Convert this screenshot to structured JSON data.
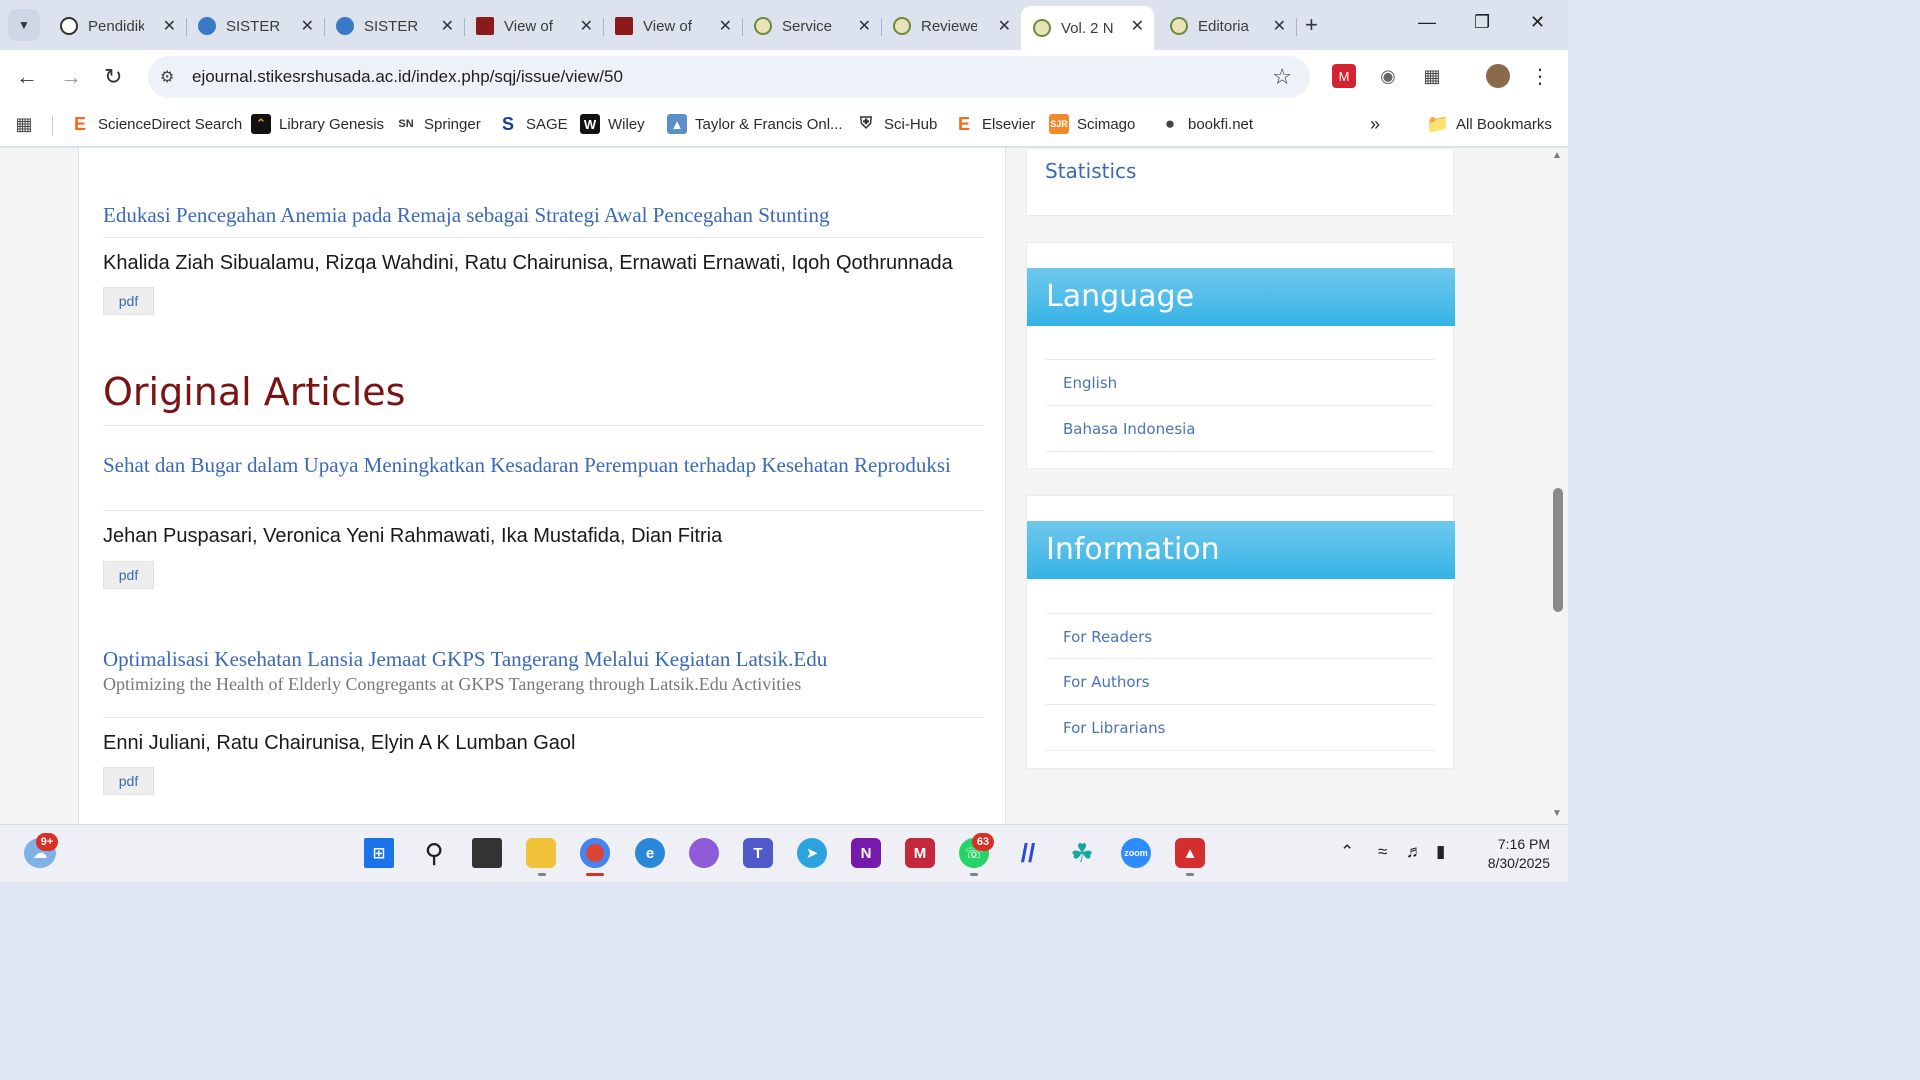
{
  "browser": {
    "tabs": [
      {
        "title": "Pendidik",
        "icon": "openai-icon"
      },
      {
        "title": "SISTER |",
        "icon": "sister-icon"
      },
      {
        "title": "SISTER |",
        "icon": "sister-icon"
      },
      {
        "title": "View of",
        "icon": "acta-medica-icon"
      },
      {
        "title": "View of",
        "icon": "acta-medica-icon"
      },
      {
        "title": "Service",
        "icon": "journal-seal-icon"
      },
      {
        "title": "Reviewe",
        "icon": "journal-seal-icon"
      },
      {
        "title": "Vol. 2 N",
        "icon": "journal-seal-icon",
        "active": true
      },
      {
        "title": "Editoria",
        "icon": "journal-seal-icon"
      }
    ],
    "url": "ejournal.stikesrshusada.ac.id/index.php/sqj/issue/view/50",
    "bookmarks": [
      {
        "label": "ScienceDirect Search",
        "icon": "elsevier-icon"
      },
      {
        "label": "Library Genesis",
        "icon": "libgen-icon"
      },
      {
        "label": "Springer",
        "icon": "springer-icon"
      },
      {
        "label": "SAGE",
        "icon": "sage-icon"
      },
      {
        "label": "Wiley",
        "icon": "wiley-icon"
      },
      {
        "label": "Taylor & Francis Onl...",
        "icon": "tandf-icon"
      },
      {
        "label": "Sci-Hub",
        "icon": "scihub-icon"
      },
      {
        "label": "Elsevier",
        "icon": "elsevier-icon"
      },
      {
        "label": "Scimago",
        "icon": "scimago-icon"
      },
      {
        "label": "bookfi.net",
        "icon": "globe-icon"
      }
    ],
    "all_bookmarks": "All Bookmarks"
  },
  "main": {
    "articles": [
      {
        "title": "Edukasi Pencegahan Anemia pada Remaja sebagai Strategi Awal Pencegahan Stunting",
        "authors": "Khalida Ziah Sibualamu, Rizqa Wahdini, Ratu Chairunisa, Ernawati Ernawati, Iqoh Qothrunnada",
        "pdf": "pdf"
      }
    ],
    "section_title": "Original Articles",
    "section_articles": [
      {
        "title": "Sehat dan Bugar dalam Upaya Meningkatkan Kesadaran Perempuan terhadap Kesehatan Reproduksi",
        "authors": "Jehan Puspasari, Veronica Yeni Rahmawati, Ika Mustafida, Dian Fitria",
        "pdf": "pdf"
      },
      {
        "title": "Optimalisasi Kesehatan Lansia Jemaat GKPS Tangerang Melalui Kegiatan Latsik.Edu",
        "subtitle": "Optimizing the Health of Elderly Congregants at GKPS Tangerang through Latsik.Edu Activities",
        "authors": "Enni Juliani, Ratu Chairunisa, Elyin A K Lumban Gaol",
        "pdf": "pdf"
      }
    ]
  },
  "sidebar": {
    "statistics": "Statistics",
    "language": {
      "title": "Language",
      "items": [
        "English",
        "Bahasa Indonesia"
      ]
    },
    "information": {
      "title": "Information",
      "items": [
        "For Readers",
        "For Authors",
        "For Librarians"
      ]
    }
  },
  "taskbar": {
    "weather_badge": "9+",
    "whatsapp_badge": "63",
    "time": "7:16 PM",
    "date": "8/30/2025"
  }
}
